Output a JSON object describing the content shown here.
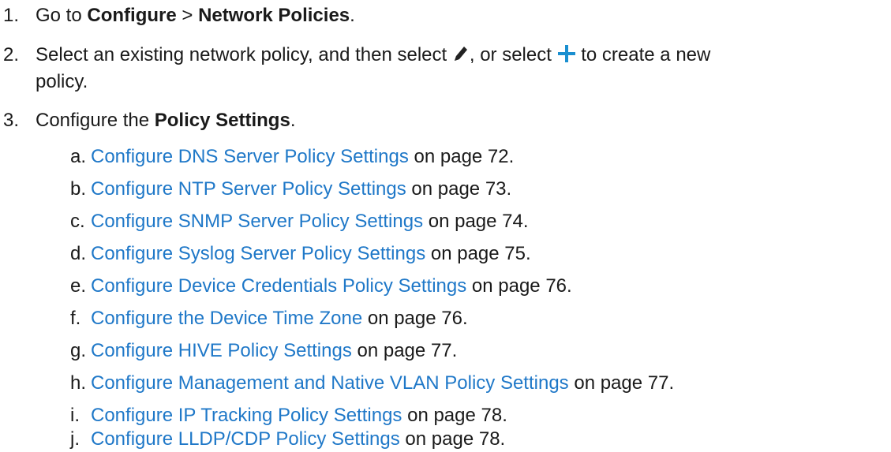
{
  "steps": [
    {
      "num": "1.",
      "t1": "Go to ",
      "b1": "Configure",
      "t2": " > ",
      "b2": "Network Policies",
      "t3": "."
    },
    {
      "num": "2.",
      "t1": "Select an existing network policy, and then select ",
      "icon1": "pencil-icon",
      "t2": ", or select ",
      "icon2": "plus-icon",
      "t3": " to create a new",
      "t4": "policy."
    },
    {
      "num": "3.",
      "t1": "Configure the ",
      "b1": "Policy Settings",
      "t2": "."
    }
  ],
  "substeps": [
    {
      "letter": "a.",
      "link": "Configure DNS Server Policy Settings",
      "suffix": " on page 72."
    },
    {
      "letter": "b.",
      "link": "Configure NTP Server Policy Settings",
      "suffix": " on page 73."
    },
    {
      "letter": "c.",
      "link": "Configure SNMP Server Policy Settings",
      "suffix": " on page 74."
    },
    {
      "letter": "d.",
      "link": "Configure Syslog Server Policy Settings",
      "suffix": " on page 75."
    },
    {
      "letter": "e.",
      "link": "Configure Device Credentials Policy Settings",
      "suffix": " on page 76."
    },
    {
      "letter": "f.",
      "link": "Configure the Device Time Zone",
      "suffix": " on page 76."
    },
    {
      "letter": "g.",
      "link": "Configure HIVE Policy Settings",
      "suffix": " on page 77."
    },
    {
      "letter": "h.",
      "link": "Configure Management and Native VLAN Policy Settings",
      "suffix": " on page 77."
    },
    {
      "letter": "i.",
      "link": "Configure IP Tracking Policy Settings",
      "suffix": " on page 78."
    },
    {
      "letter": "j.",
      "link": "Configure LLDP/CDP Policy Settings",
      "suffix": " on page 78."
    }
  ],
  "colors": {
    "text": "#1a1a1a",
    "link": "#1f78c8",
    "plus_icon": "#1a8fd0"
  }
}
